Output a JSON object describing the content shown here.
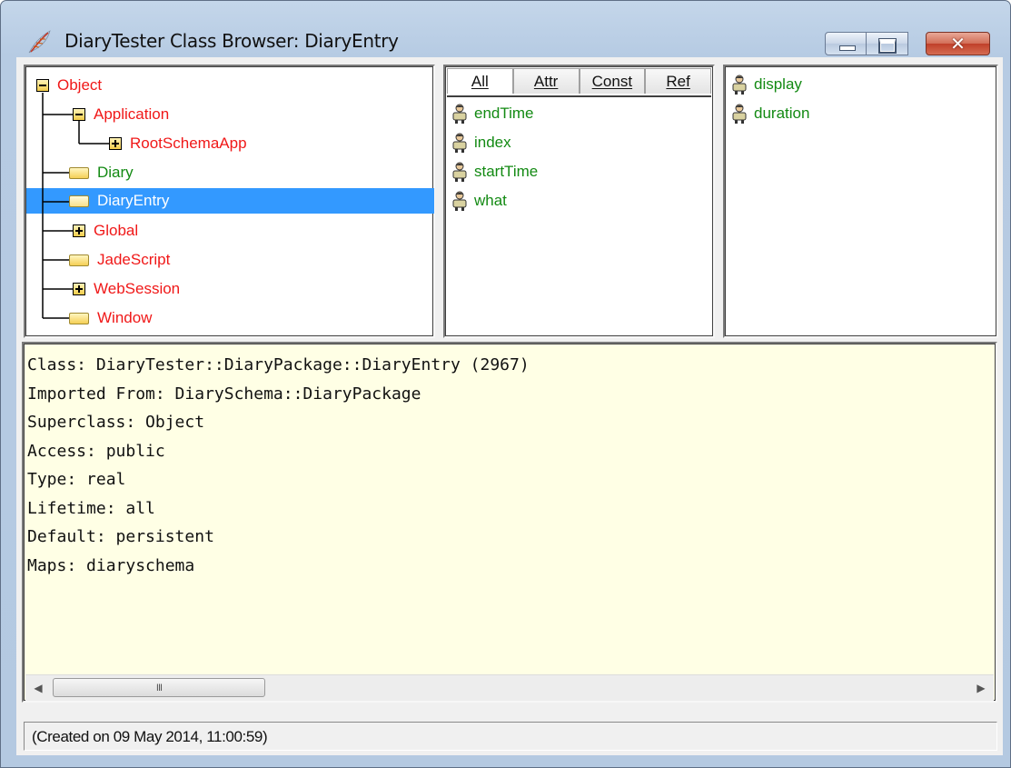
{
  "window": {
    "title": "DiaryTester Class Browser: DiaryEntry",
    "close_glyph": "✕"
  },
  "class_tree": {
    "nodes": [
      {
        "label": "Object",
        "color": "#f01818",
        "expander": "minus"
      },
      {
        "label": "Application",
        "color": "#f01818",
        "expander": "minus"
      },
      {
        "label": "RootSchemaApp",
        "color": "#f01818",
        "expander": "plus"
      },
      {
        "label": "Diary",
        "color": "#138a13",
        "expander": "none"
      },
      {
        "label": "DiaryEntry",
        "color": "#ffffff",
        "expander": "none",
        "selected": true
      },
      {
        "label": "Global",
        "color": "#f01818",
        "expander": "plus"
      },
      {
        "label": "JadeScript",
        "color": "#f01818",
        "expander": "none"
      },
      {
        "label": "WebSession",
        "color": "#f01818",
        "expander": "plus"
      },
      {
        "label": "Window",
        "color": "#f01818",
        "expander": "none"
      }
    ]
  },
  "property_tabs": {
    "tabs": [
      "All",
      "Attr",
      "Const",
      "Ref"
    ],
    "active": "All"
  },
  "properties": [
    "endTime",
    "index",
    "startTime",
    "what"
  ],
  "methods": [
    "display",
    "duration"
  ],
  "class_info": {
    "lines": [
      "Class: DiaryTester::DiaryPackage::DiaryEntry (2967)",
      "Imported From: DiarySchema::DiaryPackage",
      "Superclass: Object",
      "Access: public",
      "Type: real",
      "Lifetime: all",
      "Default: persistent",
      "Maps: diaryschema"
    ],
    "scrollbar_grip": "III"
  },
  "status_bar": {
    "text": "(Created on 09 May 2014, 11:00:59)"
  },
  "icons": {
    "app": "feather-icon",
    "expand": "plus-box-icon",
    "collapse": "minus-box-icon",
    "class": "folder-icon",
    "property": "person-icon"
  }
}
